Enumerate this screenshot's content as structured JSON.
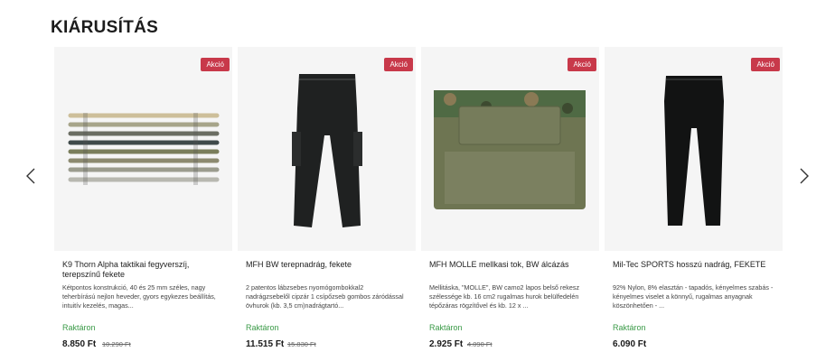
{
  "section": {
    "title": "KIÁRUSÍTÁS"
  },
  "products": [
    {
      "badge": "Akció",
      "name": "K9 Thorn Alpha taktikai fegyverszíj, terepszínű fekete",
      "description": "Kétpontos konstrukció, 40 és 25 mm széles, nagy teherbírású nejlon heveder, gyors egykezes beállítás, intuitív kezelés, magas...",
      "stock": "Raktáron",
      "price": "8.850 Ft",
      "old_price": "10.290 Ft"
    },
    {
      "badge": "Akció",
      "name": "MFH BW terepnadrág, fekete",
      "description": "2 patentos lábzsebes nyomógombokkal2 nadrágzsebelől cipzár 1 csípőzseb gombos záródással övhurok (kb. 3,5 cm)nadrágtartó...",
      "stock": "Raktáron",
      "price": "11.515 Ft",
      "old_price": "15.830 Ft"
    },
    {
      "badge": "Akció",
      "name": "MFH MOLLE mellkasi tok, BW álcázás",
      "description": "Mellitáska, \"MOLLE\", BW camo2 lapos belső rekesz szélessége kb. 16 cm2 rugalmas hurok belülfedelén tépőzáras rögzítővel és kb. 12 x ...",
      "stock": "Raktáron",
      "price": "2.925 Ft",
      "old_price": "4.090 Ft"
    },
    {
      "badge": "Akció",
      "name": "Mil-Tec SPORTS hosszú nadrág, FEKETE",
      "description": "92% Nylon, 8% elasztán - tapadós, kényelmes szabás - kényelmes viselet a könnyű, rugalmas anyagnak köszönhetően - ...",
      "stock": "Raktáron",
      "price": "6.090 Ft",
      "old_price": ""
    }
  ],
  "colors": {
    "badge": "#c8394a",
    "stock": "#3a9a47"
  },
  "icons": {
    "prev": "chevron-left-icon",
    "next": "chevron-right-icon"
  }
}
